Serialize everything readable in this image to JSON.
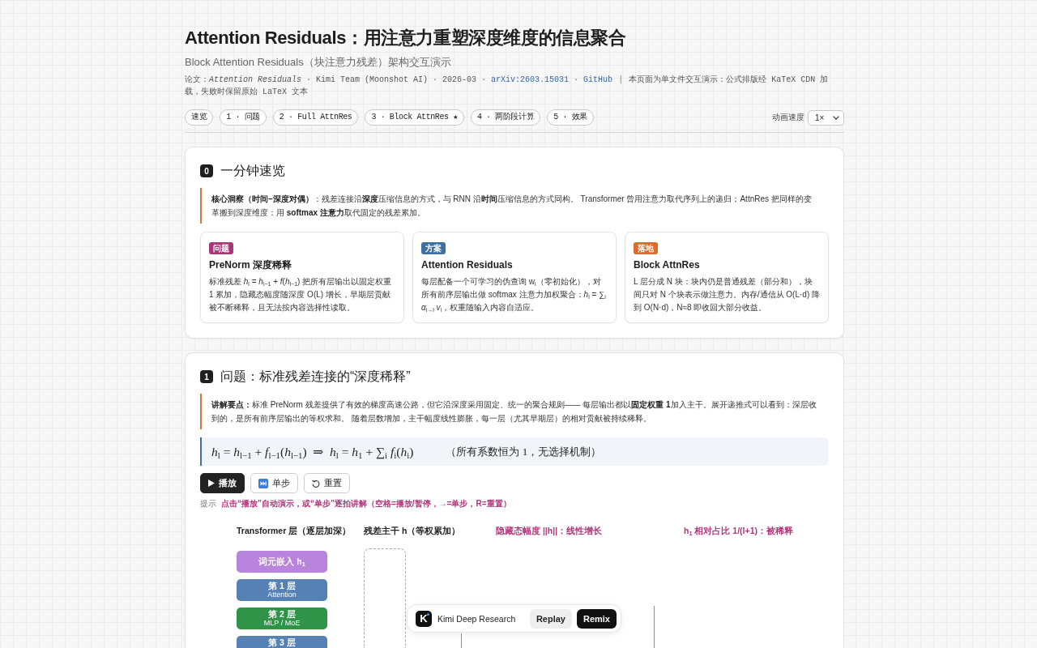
{
  "header": {
    "title": "Attention Residuals：用注意力重塑深度维度的信息聚合",
    "subtitle": "Block Attention Residuals（块注意力残差）架构交互演示",
    "meta": [
      {
        "kind": "text",
        "text": "论文：*Attention Residuals* · Kimi Team (Moonshot AI) · 2026-03 · "
      },
      {
        "kind": "link",
        "text": "arXiv:2603.15031"
      },
      {
        "kind": "text",
        "text": " · "
      },
      {
        "kind": "link",
        "text": "GitHub"
      },
      {
        "kind": "separator",
        "text": "|"
      },
      {
        "kind": "text",
        "text": "本页面为单文件交互演示：公式排版经 KaTeX CDN 加载，失败时保留原始 LaTeX 文本"
      }
    ]
  },
  "nav": {
    "links": [
      "速览",
      "1 · 问题",
      "2 · Full AttnRes",
      "3 · Block AttnRes ★",
      "4 · 两阶段计算",
      "5 · 效果"
    ],
    "speed": {
      "label": "动画速度",
      "value": "1×"
    }
  },
  "sections": [
    {
      "number": "0",
      "title": "一分钟速览",
      "callout": "**核心洞察（时间–深度对偶）**：残差连接沿**深度**压缩信息的方式，与 RNN 沿**时间**压缩信息的方式同构。 Transformer 曾用注意力取代序列上的递归；AttnRes 把同样的变革搬到深度维度：用 **softmax 注意力**取代固定的残差累加。",
      "cards": [
        {
          "tag": "问题",
          "color": "#a8387a",
          "title": "PreNorm 深度稀释",
          "text": "标准残差 *h*$_{l}$ = *h*$_{l−1}$ + *f*(*h*$_{l−1}$) 把所有层输出以固定权重 1 累加，隐藏态幅度随深度 O(L) 增长，早期层贡献被不断稀释，且无法按内容选择性读取。"
        },
        {
          "tag": "方案",
          "color": "#3d6fa5",
          "title": "Attention Residuals",
          "text": "每层配备一个可学习的伪查询 w$_{l}$（零初始化），对所有前序层输出做 softmax 注意力加权聚合：*h*$_{l}$ = ∑$_{i}$ *α*$_{i→l}$ *v*$_{i}$，权重随输入内容自适应。"
        },
        {
          "tag": "落地",
          "color": "#db6a2c",
          "title": "Block AttnRes",
          "text": "L 层分成 N 块：块内仍是普通残差（部分和），块间只对 N 个块表示做注意力。内存/通信从 O(L·d) 降到 O(N·d)，N≈8 即收回大部分收益。"
        }
      ]
    },
    {
      "number": "1",
      "title": "问题：标准残差连接的“深度稀释”",
      "callout": "**讲解要点：**标准 PreNorm 残差提供了有效的梯度高速公路，但它沿深度采用固定、统一的聚合规则—— 每层输出都以**固定权重 1**加入主干。展开递推式可以看到：深层收到的，是所有前序层输出的等权求和。 随着层数增加，主干幅度线性膨胀，每一层（尤其早期层）的相对贡献被持续稀释。",
      "formula": {
        "math": "*h*$_{l}$ = *h*$_{l−1}$ + *f*$_{l−1}$(*h*$_{l−1}$)  ⇒  *h*$_{l}$ = *h*$_{1}$ + ∑$_{i}$ *f*$_{i}$(*h*$_{i}$)",
        "note": "（所有系数恒为 1，无选择机制）"
      },
      "controls": [
        {
          "kind": "play",
          "label": "播放"
        },
        {
          "kind": "step",
          "label": "单步"
        },
        {
          "kind": "reset",
          "label": "重置"
        }
      ],
      "hint": {
        "label": "提示",
        "text": "点击“播放”自动演示，或“单步”逐拍讲解（空格=播放/暂停，→=单步，R=重置）"
      },
      "diagram": {
        "columns": [
          {
            "kind": "label",
            "text": "Transformer 层（逐层加深）"
          },
          {
            "kind": "label",
            "text": "残差主干 h（等权累加）"
          },
          {
            "kind": "metric",
            "text": "隐藏态幅度 ||h||：线性增长"
          },
          {
            "kind": "metric",
            "text": "h$_{1}$ 相对占比 1/(l+1)：被稀释"
          }
        ],
        "layers": [
          {
            "kind": "embedding",
            "title": "词元嵌入 h$_{1}$",
            "color": "#b984dc"
          },
          {
            "kind": "layer",
            "title": "第 1 层",
            "subtitle": "Attention",
            "color": "#5581b4"
          },
          {
            "kind": "layer",
            "title": "第 2 层",
            "subtitle": "MLP / MoE",
            "color": "#2f9447"
          },
          {
            "kind": "layer",
            "title": "第 3 层",
            "color": "#5581b4"
          }
        ]
      }
    }
  ],
  "badge": {
    "logo": "K",
    "name": "Kimi Deep Research",
    "buttons": [
      {
        "kind": "secondary",
        "label": "Replay"
      },
      {
        "kind": "primary",
        "label": "Remix"
      }
    ]
  }
}
